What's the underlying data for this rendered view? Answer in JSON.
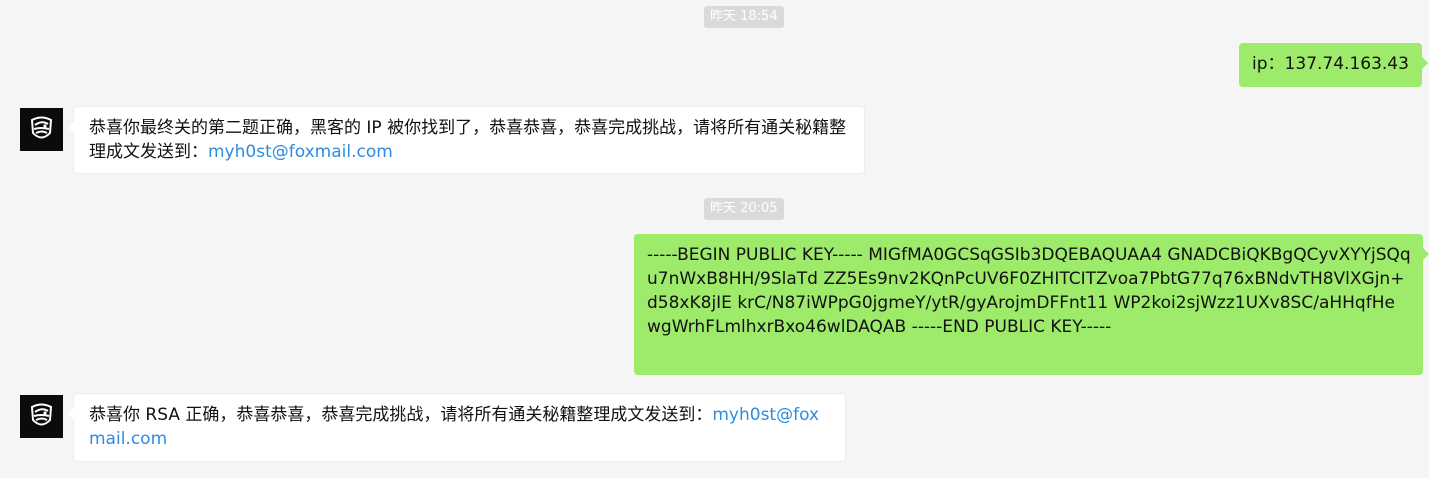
{
  "timestamps": [
    "昨天 18:54",
    "昨天 20:05"
  ],
  "messages": [
    {
      "sender": "me",
      "text": "ip：137.74.163.43"
    },
    {
      "sender": "them",
      "text": "恭喜你最终关的第二题正确，黑客的 IP 被你找到了，恭喜恭喜，恭喜完成挑战，请将所有通关秘籍整理成文发送到：",
      "link": "myh0st@foxmail.com"
    },
    {
      "sender": "me",
      "text": "-----BEGIN PUBLIC KEY----- MIGfMA0GCSqGSIb3DQEBAQUAA4 GNADCBiQKBgQCyvXYYjSQqu7nWxB8HH/9SlaTd ZZ5Es9nv2KQnPcUV6F0ZHITCITZvoa7PbtG77q76xBNdvTH8VlXGjn+d58xK8jIE krC/N87iWPpG0jgmeY/ytR/gyArojmDFFnt11 WP2koi2sjWzz1UXv8SC/aHHqfHe wgWrhFLmlhxrBxo46wlDAQAB -----END PUBLIC KEY-----"
    },
    {
      "sender": "them",
      "text": "恭喜你  RSA 正确，恭喜恭喜，恭喜完成挑战，请将所有通关秘籍整理成文发送到：",
      "link": "myh0st@foxmail.com"
    }
  ],
  "avatar": {
    "icon": "hacker-logo-icon",
    "background": "#0b0b0b"
  },
  "colors": {
    "page_background": "#f5f5f5",
    "my_bubble": "#9eea6a",
    "their_bubble": "#ffffff",
    "link": "#2f8be0",
    "timestamp_background": "#dadada"
  }
}
